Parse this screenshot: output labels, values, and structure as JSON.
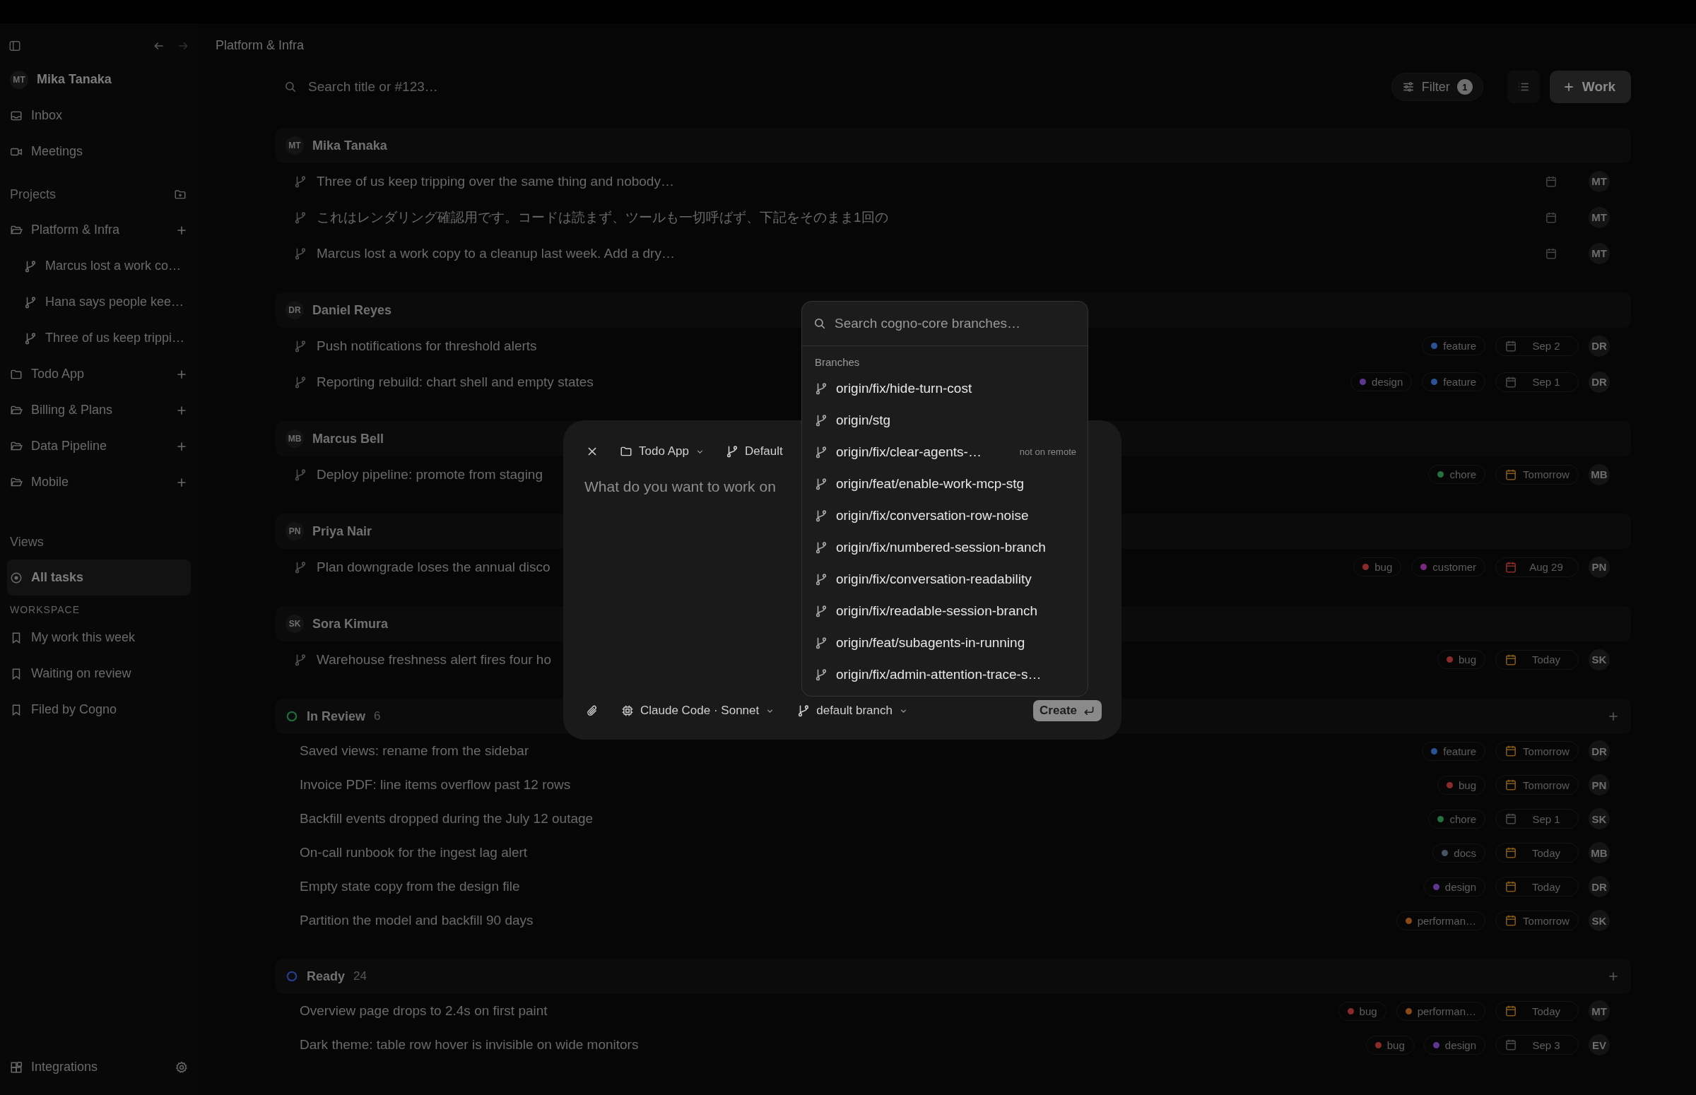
{
  "header": {
    "breadcrumb": "Platform & Infra"
  },
  "sidebar": {
    "user": {
      "name": "Mika Tanaka",
      "initials": "MT"
    },
    "nav": [
      {
        "label": "Inbox"
      },
      {
        "label": "Meetings"
      }
    ],
    "projects_title": "Projects",
    "projects": [
      {
        "name": "Platform & Infra",
        "kind": "open-folder",
        "children": [
          {
            "name": "Marcus lost a work co…"
          },
          {
            "name": "Hana says people kee…"
          },
          {
            "name": "Three of us keep trippi…"
          }
        ]
      },
      {
        "name": "Todo App",
        "kind": "folder"
      },
      {
        "name": "Billing & Plans",
        "kind": "open-folder"
      },
      {
        "name": "Data Pipeline",
        "kind": "open-folder"
      },
      {
        "name": "Mobile",
        "kind": "open-folder"
      }
    ],
    "views_title": "Views",
    "views": [
      {
        "label": "All tasks",
        "selected": true
      }
    ],
    "workspace_title": "WORKSPACE",
    "workspace": [
      {
        "label": "My work this week",
        "selected": false
      },
      {
        "label": "Waiting on review",
        "selected": false
      },
      {
        "label": "Filed by Cogno",
        "selected": false
      }
    ],
    "footer": {
      "label": "Integrations"
    }
  },
  "toolbar": {
    "search_placeholder": "Search title or #123…",
    "filter": "Filter",
    "filter_count": "1",
    "new_button": "Work"
  },
  "groups": [
    {
      "kind": "person",
      "title": "Mika Tanaka",
      "initials": "MT",
      "rows": [
        {
          "title": "Three of us keep tripping over the same thing and nobody…",
          "branch": true,
          "labels": [],
          "assignee": "MT"
        },
        {
          "title": "これはレンダリング確認用です。コードは読まず、ツールも一切呼ばず、下記をそのまま1回の",
          "branch": true,
          "labels": [],
          "assignee": "MT"
        },
        {
          "title": "Marcus lost a work copy to a cleanup last week. Add a dry…",
          "branch": true,
          "labels": [],
          "assignee": "MT"
        }
      ]
    },
    {
      "kind": "person",
      "title": "Daniel Reyes",
      "initials": "DR",
      "rows": [
        {
          "title": "Push notifications for threshold alerts",
          "branch": true,
          "labels": [
            {
              "name": "feature",
              "color": "#2c5296"
            }
          ],
          "due": {
            "text": "Sep 2",
            "color": "#484848"
          },
          "assignee": "DR"
        },
        {
          "title": "Reporting rebuild: chart shell and empty states",
          "branch": true,
          "labels": [
            {
              "name": "design",
              "color": "#5e3590"
            },
            {
              "name": "feature",
              "color": "#2c5296"
            }
          ],
          "due": {
            "text": "Sep 1",
            "color": "#484848"
          },
          "assignee": "DR"
        }
      ]
    },
    {
      "kind": "person",
      "title": "Marcus Bell",
      "initials": "MB",
      "rows": [
        {
          "title": "Deploy pipeline: promote from staging",
          "branch": true,
          "labels": [
            {
              "name": "chore",
              "color": "#237040"
            }
          ],
          "due": {
            "text": "Tomorrow",
            "color": "#80591a"
          },
          "assignee": "MB"
        }
      ]
    },
    {
      "kind": "person",
      "title": "Priya Nair",
      "initials": "PN",
      "rows": [
        {
          "title": "Plan downgrade loses the annual disco",
          "branch": true,
          "labels": [
            {
              "name": "bug",
              "color": "#8a2a2a"
            },
            {
              "name": "customer",
              "color": "#78297e"
            }
          ],
          "due": {
            "text": "Aug 29",
            "color": "#8a2a2a"
          },
          "assignee": "PN"
        }
      ]
    },
    {
      "kind": "person",
      "title": "Sora Kimura",
      "initials": "SK",
      "rows": [
        {
          "title": "Warehouse freshness alert fires four ho",
          "branch": true,
          "labels": [
            {
              "name": "bug",
              "color": "#8a2a2a"
            }
          ],
          "due": {
            "text": "Today",
            "color": "#80591a"
          },
          "assignee": "SK"
        }
      ]
    },
    {
      "kind": "status",
      "title": "In Review",
      "count": "6",
      "color": "#1d6a3a",
      "rows": [
        {
          "title": "Saved views: rename from the sidebar",
          "branch": false,
          "labels": [
            {
              "name": "feature",
              "color": "#2c5296"
            }
          ],
          "due": {
            "text": "Tomorrow",
            "color": "#80591a"
          },
          "assignee": "DR"
        },
        {
          "title": "Invoice PDF: line items overflow past 12 rows",
          "branch": false,
          "labels": [
            {
              "name": "bug",
              "color": "#8a2a2a"
            }
          ],
          "due": {
            "text": "Tomorrow",
            "color": "#80591a"
          },
          "assignee": "PN"
        },
        {
          "title": "Backfill events dropped during the July 12 outage",
          "branch": false,
          "labels": [
            {
              "name": "chore",
              "color": "#237040"
            }
          ],
          "due": {
            "text": "Sep 1",
            "color": "#484848"
          },
          "assignee": "SK"
        },
        {
          "title": "On-call runbook for the ingest lag alert",
          "branch": false,
          "labels": [
            {
              "name": "docs",
              "color": "#4a5266"
            }
          ],
          "due": {
            "text": "Today",
            "color": "#80591a"
          },
          "assignee": "MB"
        },
        {
          "title": "Empty state copy from the design file",
          "branch": false,
          "labels": [
            {
              "name": "design",
              "color": "#5e3590"
            }
          ],
          "due": {
            "text": "Today",
            "color": "#80591a"
          },
          "assignee": "DR"
        },
        {
          "title": "Partition the model and backfill 90 days",
          "branch": false,
          "labels": [
            {
              "name": "performan…",
              "color": "#8a4a18"
            }
          ],
          "due": {
            "text": "Tomorrow",
            "color": "#80591a"
          },
          "assignee": "SK"
        }
      ]
    },
    {
      "kind": "status",
      "title": "Ready",
      "count": "24",
      "color": "#283a8a",
      "rows": [
        {
          "title": "Overview page drops to 2.4s on first paint",
          "branch": false,
          "labels": [
            {
              "name": "bug",
              "color": "#8a2a2a"
            },
            {
              "name": "performan…",
              "color": "#8a4a18"
            }
          ],
          "due": {
            "text": "Today",
            "color": "#80591a"
          },
          "assignee": "MT"
        },
        {
          "title": "Dark theme: table row hover is invisible on wide monitors",
          "branch": false,
          "labels": [
            {
              "name": "bug",
              "color": "#8a2a2a"
            },
            {
              "name": "design",
              "color": "#5e3590"
            }
          ],
          "due": {
            "text": "Sep 3",
            "color": "#484848"
          },
          "assignee": "EV"
        }
      ]
    }
  ],
  "modal": {
    "project": "Todo App",
    "branch": "Default",
    "prompt_placeholder": "What do you want to work on",
    "agent": "Claude Code · Sonnet",
    "base_branch": "default branch",
    "create": "Create"
  },
  "branch_menu": {
    "placeholder": "Search cogno-core branches…",
    "section": "Branches",
    "items": [
      {
        "name": "origin/fix/hide-turn-cost"
      },
      {
        "name": "origin/stg"
      },
      {
        "name": "origin/fix/clear-agents-…",
        "note": "not on remote"
      },
      {
        "name": "origin/feat/enable-work-mcp-stg"
      },
      {
        "name": "origin/fix/conversation-row-noise"
      },
      {
        "name": "origin/fix/numbered-session-branch"
      },
      {
        "name": "origin/fix/conversation-readability"
      },
      {
        "name": "origin/fix/readable-session-branch"
      },
      {
        "name": "origin/feat/subagents-in-running"
      },
      {
        "name": "origin/fix/admin-attention-trace-s…"
      }
    ]
  }
}
